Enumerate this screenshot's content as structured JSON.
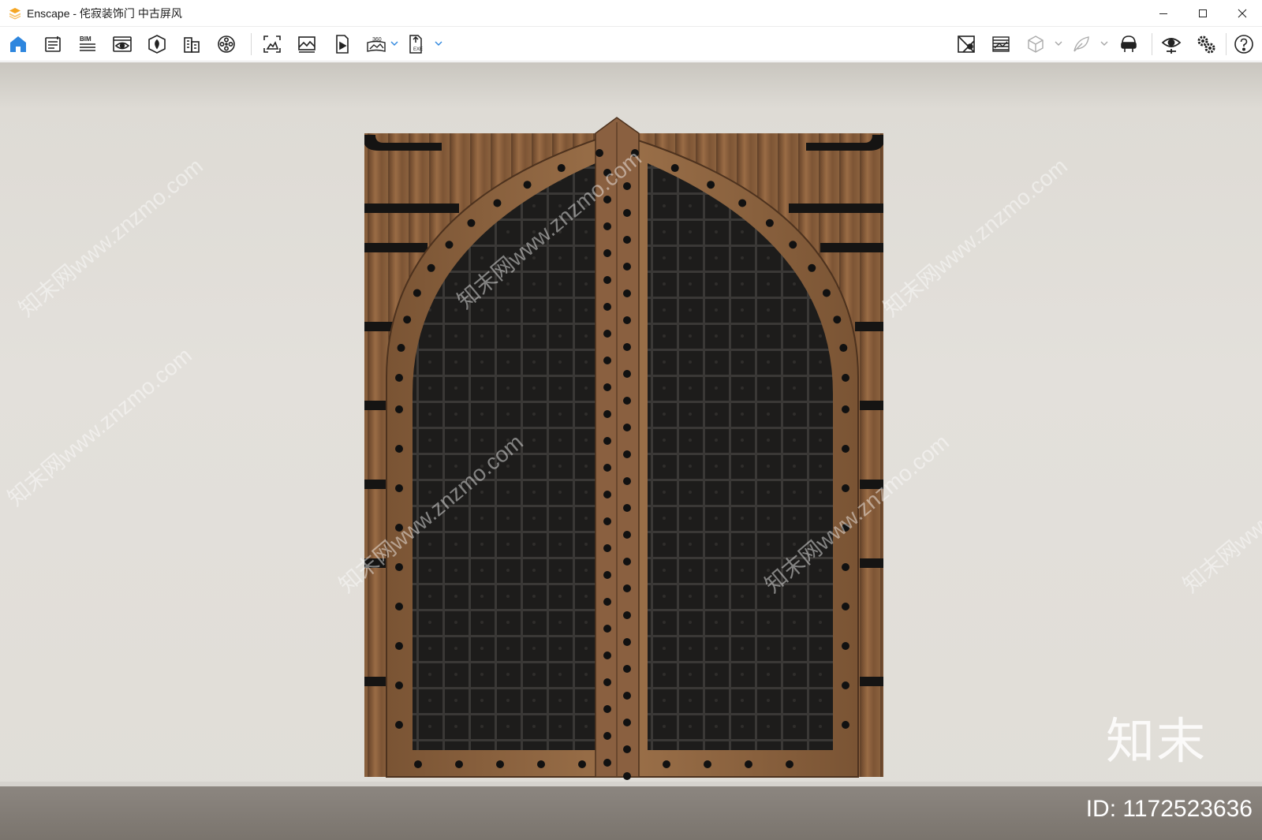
{
  "window": {
    "title": "Enscape - 侘寂装饰门 中古屏风",
    "minimize_icon": "minimize-icon",
    "maximize_icon": "maximize-icon",
    "close_icon": "close-icon"
  },
  "toolbar": {
    "left_tools": [
      {
        "id": "home",
        "icon": "home-icon",
        "active": true
      },
      {
        "id": "settings-panel",
        "icon": "list-panel-icon"
      },
      {
        "id": "bim",
        "icon": "bim-icon",
        "label": "BIM"
      },
      {
        "id": "views",
        "icon": "view-eye-icon"
      },
      {
        "id": "assets",
        "icon": "asset-library-icon"
      },
      {
        "id": "buildings",
        "icon": "buildings-icon"
      },
      {
        "id": "video",
        "icon": "film-reel-icon"
      },
      {
        "id": "screenshot",
        "icon": "screenshot-icon"
      },
      {
        "id": "gallery",
        "icon": "image-gallery-icon"
      },
      {
        "id": "batch",
        "icon": "batch-render-icon"
      },
      {
        "id": "panorama",
        "icon": "panorama-icon",
        "label": "360°"
      },
      {
        "id": "export",
        "icon": "export-exe-icon",
        "label": "EXE"
      }
    ],
    "right_tools": [
      {
        "id": "map",
        "icon": "map-icon"
      },
      {
        "id": "material",
        "icon": "material-icon"
      },
      {
        "id": "box",
        "icon": "box-icon",
        "disabled": true
      },
      {
        "id": "feather",
        "icon": "feather-icon",
        "disabled": true
      },
      {
        "id": "vr",
        "icon": "vr-headset-icon"
      },
      {
        "id": "visual",
        "icon": "visual-eye-icon"
      },
      {
        "id": "settings",
        "icon": "gears-icon"
      },
      {
        "id": "help",
        "icon": "help-icon"
      }
    ]
  },
  "viewport": {
    "watermark_text": "知末网www.znzmo.com",
    "brand_watermark": "知末",
    "id_watermark": "ID: 1172523636"
  },
  "colors": {
    "accent": "#2e86de",
    "wall": "#e2dfda",
    "wood": "#8a5f3c",
    "iron": "#1c1b1a"
  }
}
